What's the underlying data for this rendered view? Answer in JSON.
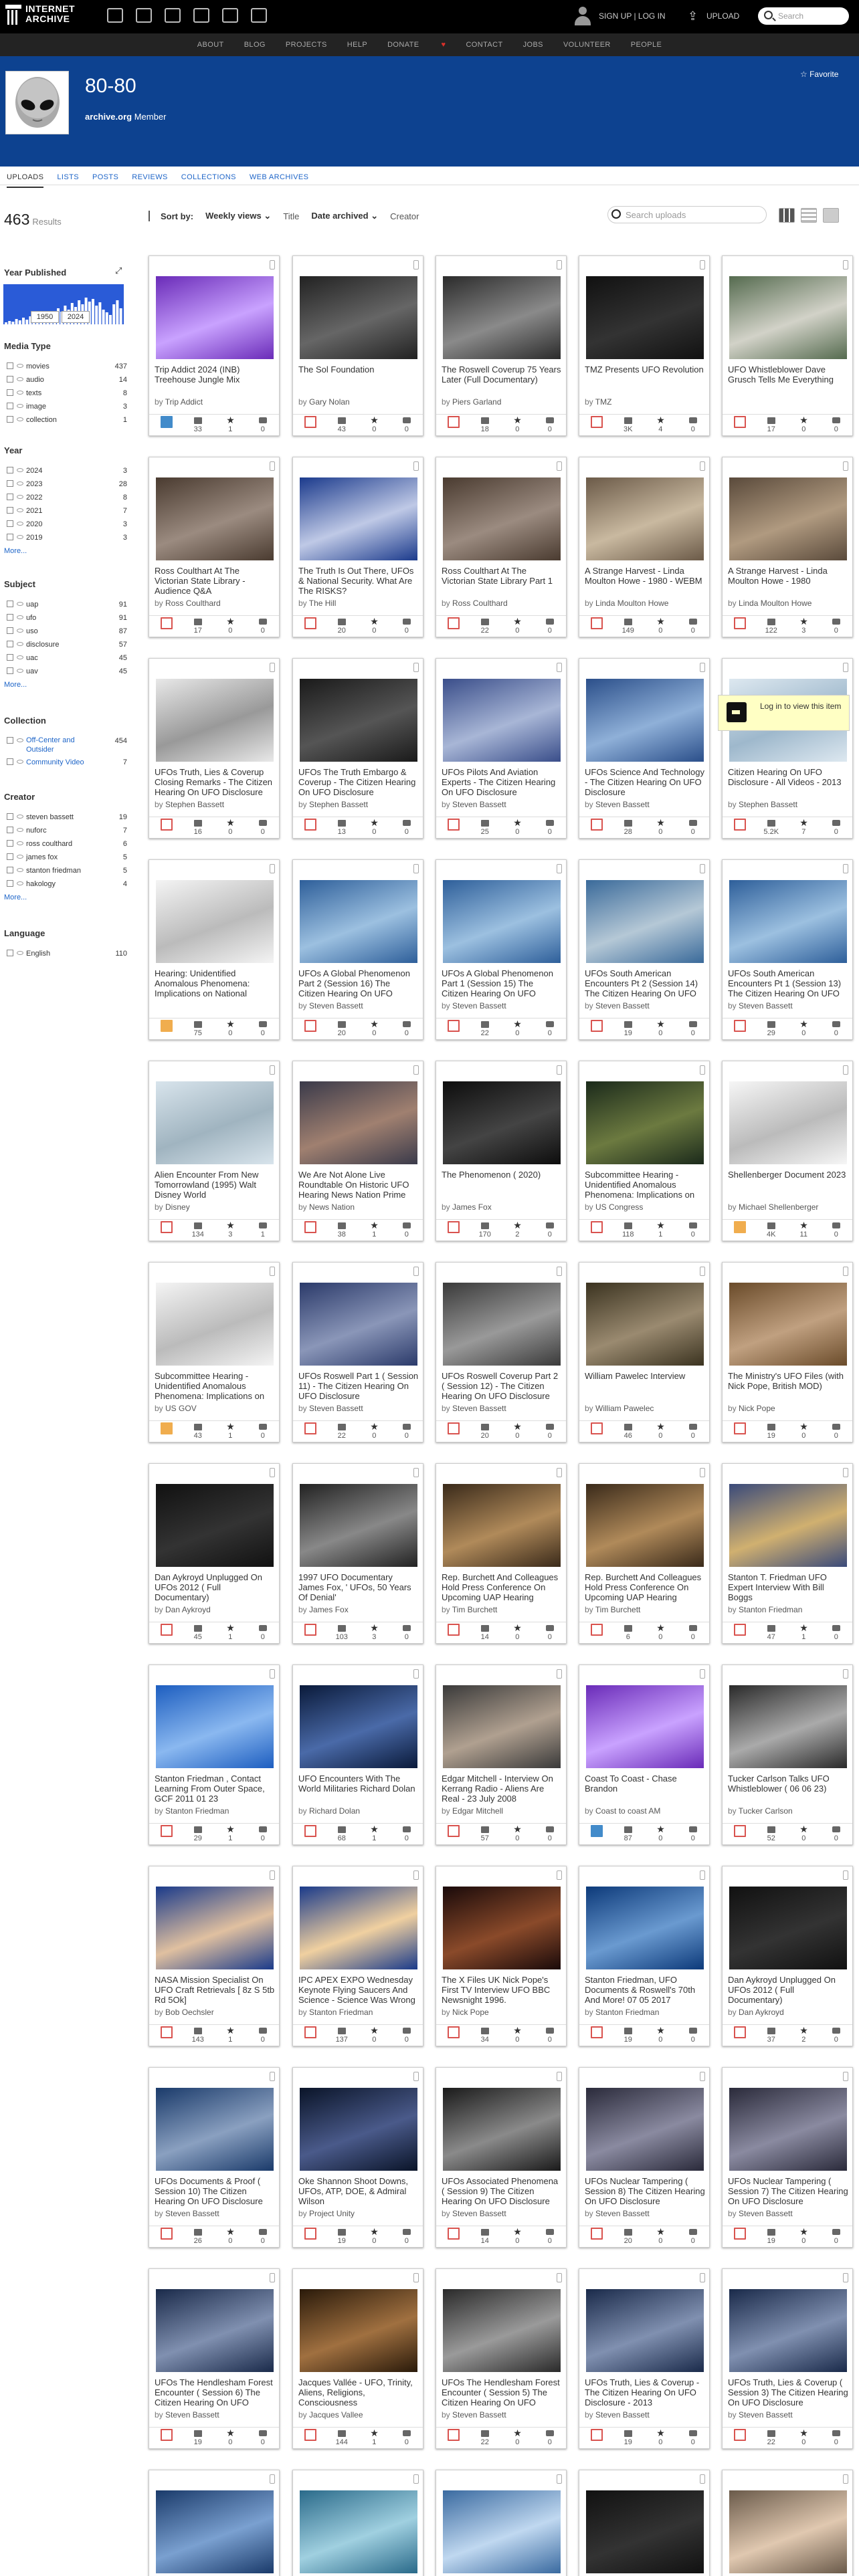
{
  "topnav": {
    "logo_line1": "INTERNET",
    "logo_line2": "ARCHIVE",
    "signup": "SIGN UP | LOG IN",
    "upload": "UPLOAD",
    "search_placeholder": "Search"
  },
  "subnav": [
    "ABOUT",
    "BLOG",
    "PROJECTS",
    "HELP",
    "DONATE",
    "CONTACT",
    "JOBS",
    "VOLUNTEER",
    "PEOPLE"
  ],
  "account": {
    "name": "80-80",
    "site": "archive.org",
    "role": "Member",
    "favorite": "Favorite"
  },
  "tabs": [
    "UPLOADS",
    "LISTS",
    "POSTS",
    "REVIEWS",
    "COLLECTIONS",
    "WEB ARCHIVES"
  ],
  "results": {
    "count": "463",
    "label": "Results"
  },
  "sortbar": {
    "label": "Sort by:",
    "weekly": "Weekly views",
    "title": "Title",
    "date": "Date archived",
    "creator": "Creator",
    "search_placeholder": "Search uploads"
  },
  "sidebar": {
    "year_published": "Year Published",
    "year_from": "1950",
    "year_to": "2024",
    "media_type": "Media Type",
    "media": [
      {
        "t": "movies",
        "n": "437"
      },
      {
        "t": "audio",
        "n": "14"
      },
      {
        "t": "texts",
        "n": "8"
      },
      {
        "t": "image",
        "n": "3"
      },
      {
        "t": "collection",
        "n": "1"
      }
    ],
    "year": "Year",
    "years": [
      {
        "t": "2024",
        "n": "3"
      },
      {
        "t": "2023",
        "n": "28"
      },
      {
        "t": "2022",
        "n": "8"
      },
      {
        "t": "2021",
        "n": "7"
      },
      {
        "t": "2020",
        "n": "3"
      },
      {
        "t": "2019",
        "n": "3"
      }
    ],
    "subject": "Subject",
    "subjects": [
      {
        "t": "uap",
        "n": "91"
      },
      {
        "t": "ufo",
        "n": "91"
      },
      {
        "t": "uso",
        "n": "87"
      },
      {
        "t": "disclosure",
        "n": "57"
      },
      {
        "t": "uac",
        "n": "45"
      },
      {
        "t": "uav",
        "n": "45"
      }
    ],
    "collection": "Collection",
    "collections": [
      {
        "t": "Off-Center and Outsider",
        "n": "454"
      },
      {
        "t": "Community Video",
        "n": "7"
      }
    ],
    "creator": "Creator",
    "creators": [
      {
        "t": "steven bassett",
        "n": "19"
      },
      {
        "t": "nuforc",
        "n": "7"
      },
      {
        "t": "ross coulthard",
        "n": "6"
      },
      {
        "t": "james fox",
        "n": "5"
      },
      {
        "t": "stanton friedman",
        "n": "5"
      },
      {
        "t": "hakology",
        "n": "4"
      }
    ],
    "language": "Language",
    "languages": [
      {
        "t": "English",
        "n": "110"
      }
    ],
    "more": "More..."
  },
  "tooltip": "Log in to view this item",
  "items": [
    {
      "title": "Trip Addict 2024 (INB) Treehouse Jungle Mix",
      "by": "Trip Addict",
      "v": "33",
      "f": "1",
      "c": "0",
      "type": "audio"
    },
    {
      "title": "The Sol Foundation",
      "by": "Gary Nolan",
      "v": "43",
      "f": "0",
      "c": "0",
      "type": "movie"
    },
    {
      "title": "The Roswell Coverup 75 Years Later (Full Documentary)",
      "by": "Piers Garland",
      "v": "18",
      "f": "0",
      "c": "0",
      "type": "movie"
    },
    {
      "title": "TMZ Presents UFO Revolution",
      "by": "TMZ",
      "v": "3K",
      "f": "4",
      "c": "0",
      "type": "movie"
    },
    {
      "title": "UFO Whistleblower Dave Grusch Tells Me Everything",
      "by": "",
      "v": "17",
      "f": "0",
      "c": "0",
      "type": "movie"
    },
    {
      "title": "Ross Coulthart At The Victorian State Library - Audience Q&A",
      "by": "Ross Coulthard",
      "v": "17",
      "f": "0",
      "c": "0",
      "type": "movie"
    },
    {
      "title": "The Truth Is Out There, UFOs & National Security. What Are The RISKS?",
      "by": "The Hill",
      "v": "20",
      "f": "0",
      "c": "0",
      "type": "movie"
    },
    {
      "title": "Ross Coulthart At The Victorian State Library Part 1",
      "by": "Ross Coulthard",
      "v": "22",
      "f": "0",
      "c": "0",
      "type": "movie"
    },
    {
      "title": "A Strange Harvest - Linda Moulton Howe - 1980 - WEBM",
      "by": "Linda Moulton Howe",
      "v": "149",
      "f": "0",
      "c": "0",
      "type": "movie"
    },
    {
      "title": "A Strange Harvest - Linda Moulton Howe - 1980",
      "by": "Linda Moulton Howe",
      "v": "122",
      "f": "3",
      "c": "0",
      "type": "movie"
    },
    {
      "title": "UFOs Truth, Lies & Coverup Closing Remarks - The Citizen Hearing On UFO Disclosure",
      "by": "Stephen Bassett",
      "v": "16",
      "f": "0",
      "c": "0",
      "type": "movie"
    },
    {
      "title": "UFOs The Truth Embargo & Coverup - The Citizen Hearing On UFO Disclosure",
      "by": "Stephen Bassett",
      "v": "13",
      "f": "0",
      "c": "0",
      "type": "movie"
    },
    {
      "title": "UFOs Pilots And Aviation Experts - The Citizen Hearing On UFO Disclosure",
      "by": "Steven Bassett",
      "v": "25",
      "f": "0",
      "c": "0",
      "type": "movie"
    },
    {
      "title": "UFOs Science And Technology - The Citizen Hearing On UFO Disclosure",
      "by": "Steven Bassett",
      "v": "28",
      "f": "0",
      "c": "0",
      "type": "movie"
    },
    {
      "title": "Citizen Hearing On UFO Disclosure - All Videos - 2013",
      "by": "Stephen Bassett",
      "v": "5.2K",
      "f": "7",
      "c": "0",
      "type": "movie"
    },
    {
      "title": "Hearing: Unidentified Anomalous Phenomena: Implications on National Security",
      "by": "",
      "v": "75",
      "f": "0",
      "c": "0",
      "type": "text"
    },
    {
      "title": "UFOs A Global Phenomenon Part 2 (Session 16) The Citizen Hearing On UFO Disclosure",
      "by": "Steven Bassett",
      "v": "20",
      "f": "0",
      "c": "0",
      "type": "movie"
    },
    {
      "title": "UFOs A Global Phenomenon Part 1 (Session 15) The Citizen Hearing On UFO Disclosure",
      "by": "Steven Bassett",
      "v": "22",
      "f": "0",
      "c": "0",
      "type": "movie"
    },
    {
      "title": "UFOs South American Encounters Pt 2 (Session 14) The Citizen Hearing On UFO Disclosure",
      "by": "Steven Bassett",
      "v": "19",
      "f": "0",
      "c": "0",
      "type": "movie"
    },
    {
      "title": "UFOs South American Encounters Pt 1 (Session 13) The Citizen Hearing On UFO Disclosure",
      "by": "Steven Bassett",
      "v": "29",
      "f": "0",
      "c": "0",
      "type": "movie"
    },
    {
      "title": "Alien Encounter From New Tomorrowland (1995) Walt Disney World",
      "by": "Disney",
      "v": "134",
      "f": "3",
      "c": "1",
      "type": "movie"
    },
    {
      "title": "We Are Not Alone Live Roundtable On Historic UFO Hearing News Nation Prime",
      "by": "News Nation",
      "v": "38",
      "f": "1",
      "c": "0",
      "type": "movie"
    },
    {
      "title": "The Phenomenon ( 2020)",
      "by": "James Fox",
      "v": "170",
      "f": "2",
      "c": "0",
      "type": "movie"
    },
    {
      "title": "Subcommittee Hearing - Unidentified Anomalous Phenomena: Implications on National Security",
      "by": "US Congress",
      "v": "118",
      "f": "1",
      "c": "0",
      "type": "movie"
    },
    {
      "title": "Shellenberger Document 2023",
      "by": "Michael Shellenberger",
      "v": "4K",
      "f": "11",
      "c": "0",
      "type": "text"
    },
    {
      "title": "Subcommittee Hearing - Unidentified Anomalous Phenomena: Implications on National Security",
      "by": "US GOV",
      "v": "43",
      "f": "1",
      "c": "0",
      "type": "text"
    },
    {
      "title": "UFOs Roswell Part 1 ( Session 11) - The Citizen Hearing On UFO Disclosure",
      "by": "Steven Bassett",
      "v": "22",
      "f": "0",
      "c": "0",
      "type": "movie"
    },
    {
      "title": "UFOs Roswell Coverup Part 2 ( Session 12) - The Citizen Hearing On UFO Disclosure",
      "by": "Steven Bassett",
      "v": "20",
      "f": "0",
      "c": "0",
      "type": "movie"
    },
    {
      "title": "William Pawelec Interview",
      "by": "William Pawelec",
      "v": "46",
      "f": "0",
      "c": "0",
      "type": "movie"
    },
    {
      "title": "The Ministry's UFO Files (with Nick Pope, British MOD)",
      "by": "Nick Pope",
      "v": "19",
      "f": "0",
      "c": "0",
      "type": "movie"
    },
    {
      "title": "Dan Aykroyd Unplugged On UFOs 2012 ( Full Documentary)",
      "by": "Dan Aykroyd",
      "v": "45",
      "f": "1",
      "c": "0",
      "type": "movie"
    },
    {
      "title": "1997 UFO Documentary James Fox, ' UFOs, 50 Years Of Denial'",
      "by": "James Fox",
      "v": "103",
      "f": "3",
      "c": "0",
      "type": "movie"
    },
    {
      "title": "Rep. Burchett And Colleagues Hold Press Conference On Upcoming UAP Hearing",
      "by": "Tim Burchett",
      "v": "14",
      "f": "0",
      "c": "0",
      "type": "movie"
    },
    {
      "title": "Rep. Burchett And Colleagues Hold Press Conference On Upcoming UAP Hearing",
      "by": "Tim Burchett",
      "v": "6",
      "f": "0",
      "c": "0",
      "type": "movie"
    },
    {
      "title": "Stanton T. Friedman UFO Expert Interview With Bill Boggs",
      "by": "Stanton Friedman",
      "v": "47",
      "f": "1",
      "c": "0",
      "type": "movie"
    },
    {
      "title": "Stanton Friedman , Contact Learning From Outer Space, GCF 2011 01 23",
      "by": "Stanton Friedman",
      "v": "29",
      "f": "1",
      "c": "0",
      "type": "movie"
    },
    {
      "title": "UFO Encounters With The World Militaries Richard Dolan",
      "by": "Richard Dolan",
      "v": "68",
      "f": "1",
      "c": "0",
      "type": "movie"
    },
    {
      "title": "Edgar Mitchell - Interview On Kerrang Radio - Aliens Are Real - 23 July 2008",
      "by": "Edgar Mitchell",
      "v": "57",
      "f": "0",
      "c": "0",
      "type": "movie"
    },
    {
      "title": "Coast To Coast - Chase Brandon",
      "by": "Coast to coast AM",
      "v": "87",
      "f": "0",
      "c": "0",
      "type": "audio"
    },
    {
      "title": "Tucker Carlson Talks UFO Whistleblower ( 06 06 23)",
      "by": "Tucker Carlson",
      "v": "52",
      "f": "0",
      "c": "0",
      "type": "movie"
    },
    {
      "title": "NASA Mission Specialist On UFO Craft Retrievals [ 8z S 5tb Rd 5Ok]",
      "by": "Bob Oechsler",
      "v": "143",
      "f": "1",
      "c": "0",
      "type": "movie"
    },
    {
      "title": "IPC APEX EXPO Wednesday Keynote Flying Saucers And Science - Science Was Wrong",
      "by": "Stanton Friedman",
      "v": "137",
      "f": "0",
      "c": "0",
      "type": "movie"
    },
    {
      "title": "The X Files UK Nick Pope's First TV Interview UFO BBC Newsnight 1996.",
      "by": "Nick Pope",
      "v": "34",
      "f": "0",
      "c": "0",
      "type": "movie"
    },
    {
      "title": "Stanton Friedman, UFO Documents & Roswell's 70th And More! 07 05 2017",
      "by": "Stanton Friedman",
      "v": "19",
      "f": "0",
      "c": "0",
      "type": "movie"
    },
    {
      "title": "Dan Aykroyd Unplugged On UFOs 2012 ( Full Documentary)",
      "by": "Dan Aykroyd",
      "v": "37",
      "f": "2",
      "c": "0",
      "type": "movie"
    },
    {
      "title": "UFOs Documents & Proof ( Session 10)  The Citizen Hearing On UFO Disclosure",
      "by": "Steven Bassett",
      "v": "26",
      "f": "0",
      "c": "0",
      "type": "movie"
    },
    {
      "title": "Oke Shannon  Shoot Downs, UFOs, ATP, DOE, & Admiral Wilson",
      "by": "Project Unity",
      "v": "19",
      "f": "0",
      "c": "0",
      "type": "movie"
    },
    {
      "title": "UFOs Associated Phenomena ( Session 9) The Citizen Hearing On UFO Disclosure",
      "by": "Steven Bassett",
      "v": "14",
      "f": "0",
      "c": "0",
      "type": "movie"
    },
    {
      "title": "UFOs Nuclear Tampering ( Session 8)  The Citizen Hearing On UFO Disclosure",
      "by": "Steven Bassett",
      "v": "20",
      "f": "0",
      "c": "0",
      "type": "movie"
    },
    {
      "title": "UFOs Nuclear Tampering ( Session 7)  The Citizen Hearing On UFO Disclosure",
      "by": "Steven Bassett",
      "v": "19",
      "f": "0",
      "c": "0",
      "type": "movie"
    },
    {
      "title": "UFOs The Hendlesham Forest Encounter ( Session 6)  The Citizen Hearing On UFO Disclosure",
      "by": "Steven Bassett",
      "v": "19",
      "f": "0",
      "c": "0",
      "type": "movie"
    },
    {
      "title": "Jacques Vallée - UFO, Trinity, Aliens, Religions, Consciousness",
      "by": "Jacques Vallee",
      "v": "144",
      "f": "1",
      "c": "0",
      "type": "movie"
    },
    {
      "title": "UFOs The Hendlesham Forest Encounter ( Session 5)  The Citizen Hearing On UFO Disclosure",
      "by": "Steven Bassett",
      "v": "22",
      "f": "0",
      "c": "0",
      "type": "movie"
    },
    {
      "title": "UFOs Truth, Lies & Coverup - The Citizen Hearing On UFO Disclosure - 2013",
      "by": "Steven Bassett",
      "v": "19",
      "f": "0",
      "c": "0",
      "type": "movie"
    },
    {
      "title": "UFOs Truth, Lies & Coverup ( Session 3)  The Citizen Hearing On UFO Disclosure",
      "by": "Steven Bassett",
      "v": "22",
      "f": "0",
      "c": "0",
      "type": "movie"
    },
    {
      "title": "",
      "by": "",
      "v": "",
      "f": "",
      "c": "",
      "type": "movie"
    },
    {
      "title": "",
      "by": "",
      "v": "",
      "f": "",
      "c": "",
      "type": "movie"
    },
    {
      "title": "",
      "by": "",
      "v": "",
      "f": "",
      "c": "",
      "type": "movie"
    },
    {
      "title": "",
      "by": "",
      "v": "",
      "f": "",
      "c": "",
      "type": "movie"
    },
    {
      "title": "",
      "by": "",
      "v": "",
      "f": "",
      "c": "",
      "type": "movie"
    }
  ]
}
